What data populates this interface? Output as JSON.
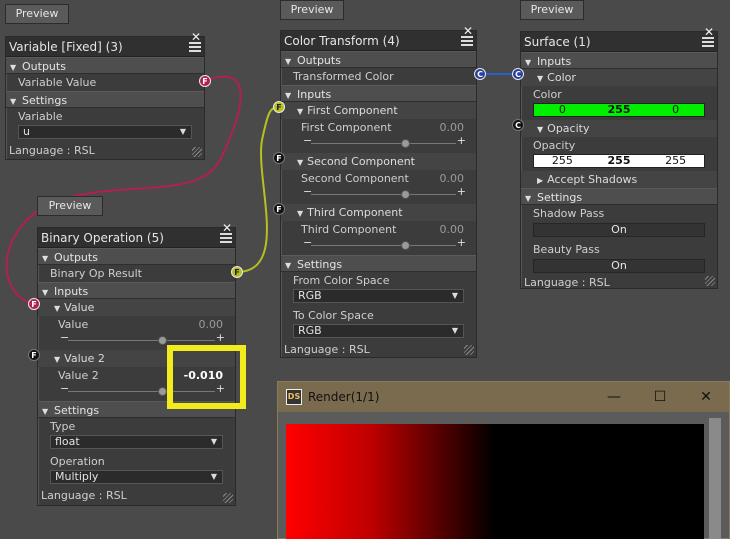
{
  "preview_label": "Preview",
  "language_label": "Language : RSL",
  "variable_node": {
    "title": "Variable [Fixed] (3)",
    "outputs": "Outputs",
    "output_item": "Variable Value",
    "settings": "Settings",
    "variable_label": "Variable",
    "variable_value": "u"
  },
  "binary_node": {
    "title": "Binary Operation (5)",
    "outputs": "Outputs",
    "output_item": "Binary Op Result",
    "inputs": "Inputs",
    "value_section": "Value",
    "value_label": "Value",
    "value_value": "0.00",
    "value_slider_level": 0.5,
    "value2_section": "Value 2",
    "value2_label": "Value 2",
    "value2_value": "-0.010",
    "value2_slider_level": 0.5,
    "settings": "Settings",
    "type_label": "Type",
    "type_value": "float",
    "operation_label": "Operation",
    "operation_value": "Multiply"
  },
  "color_transform_node": {
    "title": "Color Transform (4)",
    "outputs": "Outputs",
    "output_item": "Transformed Color",
    "inputs": "Inputs",
    "first_section": "First Component",
    "first_label": "First Component",
    "first_value": "0.00",
    "second_section": "Second Component",
    "second_label": "Second Component",
    "second_value": "0.00",
    "third_section": "Third Component",
    "third_label": "Third Component",
    "third_value": "0.00",
    "settings": "Settings",
    "from_label": "From Color Space",
    "from_value": "RGB",
    "to_label": "To Color Space",
    "to_value": "RGB"
  },
  "surface_node": {
    "title": "Surface (1)",
    "inputs": "Inputs",
    "color_section": "Color",
    "color_label": "Color",
    "color_r": "0",
    "color_g": "255",
    "color_b": "0",
    "opacity_section": "Opacity",
    "opacity_label": "Opacity",
    "opacity_r": "255",
    "opacity_g": "255",
    "opacity_b": "255",
    "accept_shadows": "Accept Shadows",
    "settings": "Settings",
    "shadow_pass_label": "Shadow Pass",
    "shadow_pass_value": "On",
    "beauty_pass_label": "Beauty Pass",
    "beauty_pass_value": "On"
  },
  "ports": {
    "f": "F",
    "c": "C"
  },
  "render_window": {
    "title": "Render(1/1)",
    "icon_text": "DS",
    "minimize": "—",
    "maximize": "☐",
    "close": "✕"
  },
  "colors": {
    "wire_red": "#b02050",
    "wire_yellow": "#b8c020",
    "wire_blue": "#2a5fd0",
    "highlight": "#f2ec1c",
    "surface_color_green": "#00ee00"
  }
}
